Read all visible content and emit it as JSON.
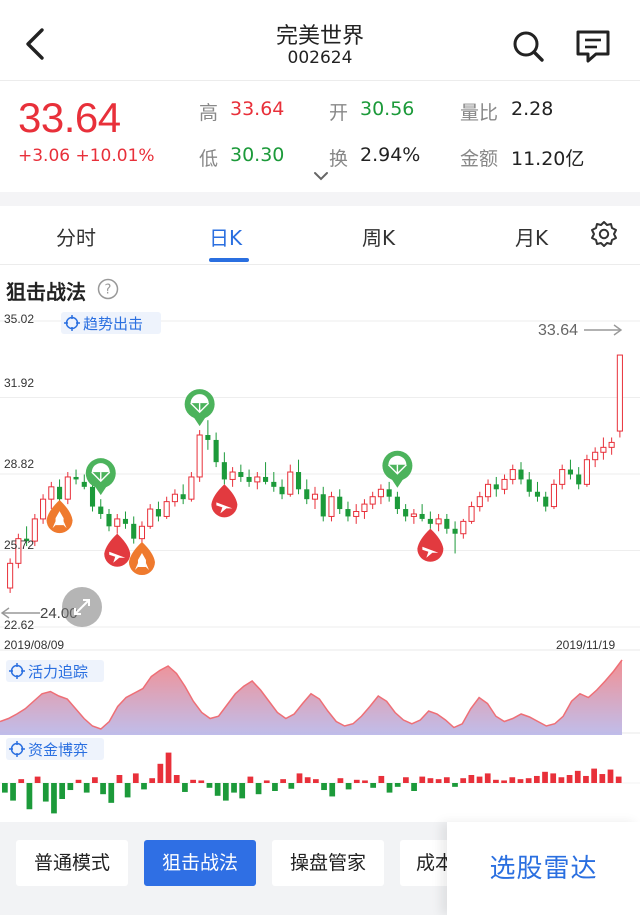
{
  "header": {
    "title": "完美世界",
    "code": "002624"
  },
  "quote": {
    "price": "33.64",
    "change": "+3.06 +10.01%",
    "high_label": "高",
    "high": "33.64",
    "low_label": "低",
    "low": "30.30",
    "open_label": "开",
    "open": "30.56",
    "turnover_label": "换",
    "turnover": "2.94%",
    "volume_ratio_label": "量比",
    "volume_ratio": "2.28",
    "amount_label": "金额",
    "amount": "11.20亿"
  },
  "tabs": [
    {
      "label": "分时"
    },
    {
      "label": "日K"
    },
    {
      "label": "周K"
    },
    {
      "label": "月K"
    }
  ],
  "active_tab": "日K",
  "section_title": "狙击战法",
  "chart": {
    "tag_trend": "趋势出击",
    "y_ticks": [
      "35.02",
      "31.92",
      "28.82",
      "25.72",
      "22.62"
    ],
    "last_price_label": "33.64",
    "min_label": "24.00",
    "start_date": "2019/08/09",
    "end_date": "2019/11/19",
    "tag_vitality": "活力追踪",
    "tag_capital": "资金博弈"
  },
  "chart_data": {
    "type": "candlestick",
    "ylim": [
      22.62,
      35.02
    ],
    "y_ticks": [
      35.02,
      31.92,
      28.82,
      25.72,
      22.62
    ],
    "x_range": [
      "2019/08/09",
      "2019/11/19"
    ],
    "last_close": 33.64,
    "period_low": 24.0,
    "candles_ohlc": [
      [
        24.2,
        25.4,
        24.0,
        25.2
      ],
      [
        25.2,
        26.4,
        25.0,
        26.2
      ],
      [
        26.2,
        26.7,
        25.9,
        26.1
      ],
      [
        26.1,
        27.2,
        25.9,
        27.0
      ],
      [
        27.0,
        28.0,
        26.8,
        27.8
      ],
      [
        27.8,
        28.5,
        27.4,
        28.3
      ],
      [
        28.3,
        28.6,
        27.6,
        27.8
      ],
      [
        27.8,
        28.9,
        27.6,
        28.7
      ],
      [
        28.7,
        29.0,
        28.4,
        28.6
      ],
      [
        28.5,
        28.8,
        28.2,
        28.3
      ],
      [
        28.3,
        28.4,
        27.3,
        27.5
      ],
      [
        27.5,
        27.8,
        27.0,
        27.2
      ],
      [
        27.2,
        27.4,
        26.5,
        26.7
      ],
      [
        26.7,
        27.2,
        26.4,
        27.0
      ],
      [
        27.0,
        27.3,
        26.6,
        26.8
      ],
      [
        26.8,
        27.1,
        26.0,
        26.2
      ],
      [
        26.2,
        26.9,
        25.9,
        26.7
      ],
      [
        26.7,
        27.6,
        26.6,
        27.4
      ],
      [
        27.4,
        27.7,
        26.9,
        27.1
      ],
      [
        27.1,
        27.9,
        27.0,
        27.7
      ],
      [
        27.7,
        28.2,
        27.5,
        28.0
      ],
      [
        28.0,
        28.4,
        27.6,
        27.8
      ],
      [
        27.8,
        28.9,
        27.7,
        28.7
      ],
      [
        28.7,
        30.6,
        28.5,
        30.4
      ],
      [
        30.4,
        31.0,
        29.8,
        30.2
      ],
      [
        30.2,
        30.5,
        29.1,
        29.3
      ],
      [
        29.3,
        29.7,
        28.4,
        28.6
      ],
      [
        28.6,
        29.1,
        28.3,
        28.9
      ],
      [
        28.9,
        29.2,
        28.5,
        28.7
      ],
      [
        28.7,
        29.0,
        28.3,
        28.5
      ],
      [
        28.5,
        28.9,
        28.2,
        28.7
      ],
      [
        28.7,
        29.3,
        28.4,
        28.5
      ],
      [
        28.5,
        28.9,
        28.1,
        28.3
      ],
      [
        28.3,
        28.6,
        27.8,
        28.0
      ],
      [
        28.0,
        29.2,
        27.9,
        28.9
      ],
      [
        28.9,
        29.4,
        28.0,
        28.2
      ],
      [
        28.2,
        28.6,
        27.6,
        27.8
      ],
      [
        27.8,
        28.3,
        27.4,
        28.0
      ],
      [
        28.0,
        28.3,
        26.9,
        27.1
      ],
      [
        27.1,
        28.1,
        26.9,
        27.9
      ],
      [
        27.9,
        28.2,
        27.2,
        27.4
      ],
      [
        27.4,
        27.7,
        26.9,
        27.1
      ],
      [
        27.1,
        27.6,
        26.8,
        27.3
      ],
      [
        27.3,
        27.8,
        27.0,
        27.6
      ],
      [
        27.6,
        28.1,
        27.4,
        27.9
      ],
      [
        27.9,
        28.4,
        27.6,
        28.2
      ],
      [
        28.2,
        28.5,
        27.7,
        27.9
      ],
      [
        27.9,
        28.1,
        27.2,
        27.4
      ],
      [
        27.4,
        27.6,
        26.9,
        27.1
      ],
      [
        27.1,
        27.4,
        26.8,
        27.2
      ],
      [
        27.2,
        27.6,
        26.9,
        27.0
      ],
      [
        27.0,
        27.3,
        26.6,
        26.8
      ],
      [
        26.8,
        27.2,
        26.5,
        27.0
      ],
      [
        27.0,
        27.2,
        26.4,
        26.6
      ],
      [
        26.6,
        26.9,
        25.6,
        26.4
      ],
      [
        26.4,
        27.0,
        26.2,
        26.9
      ],
      [
        26.9,
        27.7,
        26.8,
        27.5
      ],
      [
        27.5,
        28.1,
        27.3,
        27.9
      ],
      [
        27.9,
        28.6,
        27.7,
        28.4
      ],
      [
        28.4,
        28.7,
        27.9,
        28.2
      ],
      [
        28.2,
        28.8,
        28.0,
        28.6
      ],
      [
        28.6,
        29.2,
        28.4,
        29.0
      ],
      [
        29.0,
        29.3,
        28.4,
        28.6
      ],
      [
        28.6,
        28.9,
        27.9,
        28.1
      ],
      [
        28.1,
        28.5,
        27.7,
        27.9
      ],
      [
        27.9,
        28.1,
        27.3,
        27.5
      ],
      [
        27.5,
        28.6,
        27.4,
        28.4
      ],
      [
        28.4,
        29.2,
        28.2,
        29.0
      ],
      [
        29.0,
        29.4,
        28.6,
        28.8
      ],
      [
        28.8,
        29.1,
        28.2,
        28.4
      ],
      [
        28.4,
        29.6,
        28.3,
        29.4
      ],
      [
        29.4,
        29.9,
        29.1,
        29.7
      ],
      [
        29.7,
        30.3,
        29.4,
        29.9
      ],
      [
        29.9,
        30.3,
        29.6,
        30.1
      ],
      [
        30.56,
        33.64,
        30.3,
        33.64
      ]
    ],
    "signals": [
      {
        "kind": "rocket",
        "index": 6
      },
      {
        "kind": "parachute",
        "index": 11
      },
      {
        "kind": "plane-down",
        "index": 13
      },
      {
        "kind": "rocket",
        "index": 16
      },
      {
        "kind": "parachute",
        "index": 23
      },
      {
        "kind": "plane-down",
        "index": 26
      },
      {
        "kind": "parachute",
        "index": 47
      },
      {
        "kind": "plane-down",
        "index": 51
      }
    ],
    "vitality": [
      0.18,
      0.22,
      0.28,
      0.35,
      0.45,
      0.55,
      0.58,
      0.52,
      0.48,
      0.35,
      0.22,
      0.12,
      0.08,
      0.18,
      0.38,
      0.5,
      0.56,
      0.62,
      0.78,
      0.86,
      0.92,
      0.82,
      0.65,
      0.45,
      0.3,
      0.22,
      0.25,
      0.4,
      0.55,
      0.65,
      0.72,
      0.6,
      0.45,
      0.3,
      0.22,
      0.28,
      0.42,
      0.55,
      0.48,
      0.32,
      0.18,
      0.12,
      0.15,
      0.25,
      0.38,
      0.52,
      0.45,
      0.3,
      0.2,
      0.15,
      0.2,
      0.32,
      0.28,
      0.2,
      0.1,
      0.15,
      0.35,
      0.5,
      0.42,
      0.25,
      0.18,
      0.22,
      0.28,
      0.24,
      0.18,
      0.12,
      0.15,
      0.25,
      0.45,
      0.55,
      0.5,
      0.6,
      0.72,
      0.85,
      1.0
    ],
    "capital_flow": [
      -0.3,
      -0.55,
      0.12,
      -0.82,
      0.2,
      -0.58,
      -0.95,
      -0.5,
      -0.22,
      0.1,
      -0.3,
      0.18,
      -0.35,
      -0.62,
      0.25,
      -0.45,
      0.3,
      -0.2,
      0.15,
      0.6,
      0.95,
      0.25,
      -0.28,
      0.1,
      0.08,
      -0.15,
      -0.4,
      -0.55,
      -0.3,
      -0.48,
      0.2,
      -0.35,
      0.08,
      -0.25,
      0.12,
      -0.18,
      0.3,
      0.18,
      0.12,
      -0.22,
      -0.42,
      0.15,
      -0.2,
      0.1,
      0.08,
      -0.15,
      0.22,
      -0.3,
      -0.12,
      0.18,
      -0.25,
      0.2,
      0.15,
      0.12,
      0.18,
      -0.12,
      0.15,
      0.25,
      0.2,
      0.3,
      0.1,
      0.08,
      0.18,
      0.12,
      0.15,
      0.22,
      0.35,
      0.3,
      0.18,
      0.25,
      0.38,
      0.22,
      0.45,
      0.28,
      0.42,
      0.2
    ]
  },
  "modes": [
    {
      "label": "普通模式"
    },
    {
      "label": "狙击战法"
    },
    {
      "label": "操盘管家"
    },
    {
      "label": "成本"
    }
  ],
  "radar_label": "选股雷达",
  "colors": {
    "up": "#e8303a",
    "down": "#1c9a3a",
    "accent": "#2a6fe0"
  }
}
